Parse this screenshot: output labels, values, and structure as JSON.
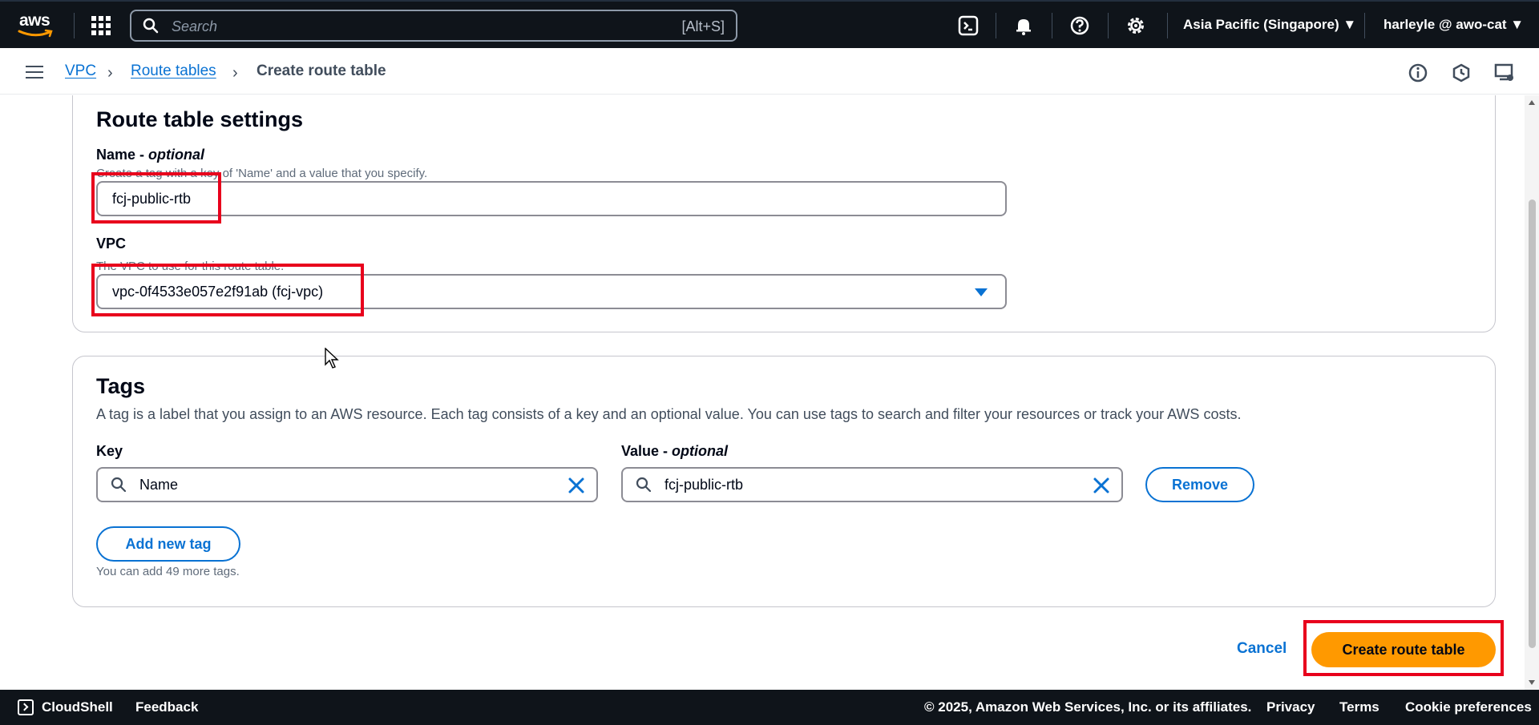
{
  "topnav": {
    "logo": "aws",
    "search_placeholder": "Search",
    "search_shortcut": "[Alt+S]",
    "icons": [
      "cloudshell-icon",
      "bell-icon",
      "help-icon",
      "settings-icon"
    ],
    "region": "Asia Pacific (Singapore) ▼",
    "user": "harleyle @ awo-cat ▼"
  },
  "breadcrumb": {
    "items": [
      {
        "label": "VPC"
      },
      {
        "label": "Route tables"
      },
      {
        "label": "Create route table"
      }
    ],
    "separator": "›"
  },
  "settings": {
    "title": "Route table settings",
    "name_label": "Name",
    "name_optional": "optional",
    "name_desc": "Create a tag with a key of 'Name' and a value that you specify.",
    "name_value": "fcj-public-rtb",
    "vpc_label": "VPC",
    "vpc_desc": "The VPC to use for this route table.",
    "vpc_value": "vpc-0f4533e057e2f91ab (fcj-vpc)"
  },
  "tags": {
    "title": "Tags",
    "desc": "A tag is a label that you assign to an AWS resource. Each tag consists of a key and an optional value. You can use tags to search and filter your resources or track your AWS costs.",
    "key_label": "Key",
    "value_label": "Value",
    "value_optional": "optional",
    "key_value": "Name",
    "value_value": "fcj-public-rtb",
    "remove_label": "Remove",
    "add_label": "Add new tag",
    "hint": "You can add 49 more tags."
  },
  "actions": {
    "cancel": "Cancel",
    "create": "Create route table"
  },
  "footer": {
    "cloudshell": "CloudShell",
    "feedback": "Feedback",
    "copyright": "© 2025, Amazon Web Services, Inc. or its affiliates.",
    "privacy": "Privacy",
    "terms": "Terms",
    "cookies": "Cookie preferences"
  },
  "colors": {
    "highlight": "#e8001c",
    "primary": "#ff9900",
    "link": "#0972d3",
    "nav_bg": "#0f141a"
  }
}
